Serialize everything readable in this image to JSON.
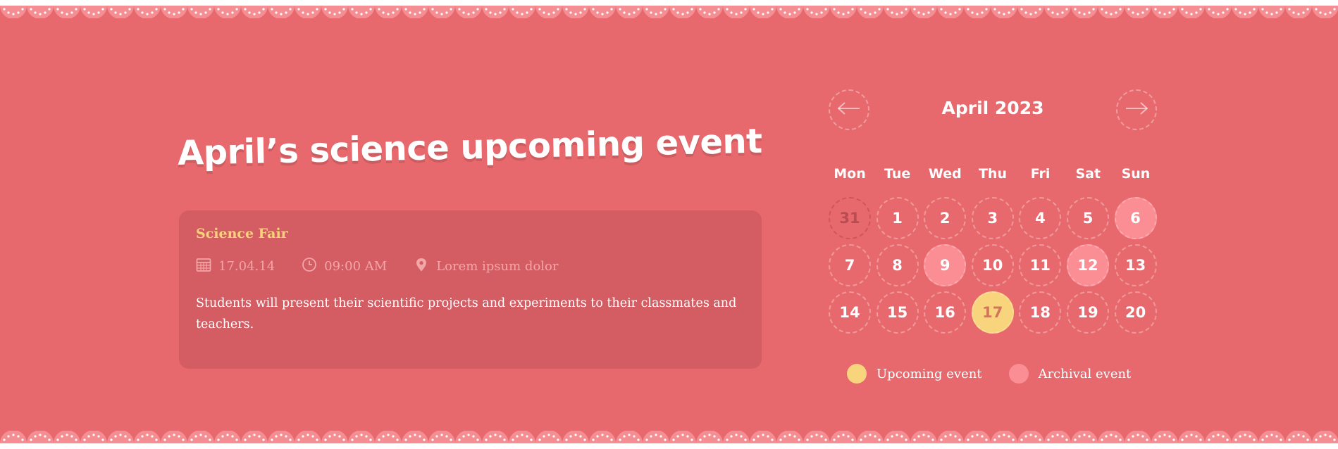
{
  "page": {
    "title": "April’s science upcoming event"
  },
  "event": {
    "name": "Science Fair",
    "date": "17.04.14",
    "time": "09:00 AM",
    "location": "Lorem ipsum dolor",
    "description": "Students will present their scientific projects and experiments to their classmates and teachers."
  },
  "calendar": {
    "month_label": "April 2023",
    "prev_icon": "arrow-left-icon",
    "next_icon": "arrow-right-icon",
    "weekdays": [
      "Mon",
      "Tue",
      "Wed",
      "Thu",
      "Fri",
      "Sat",
      "Sun"
    ],
    "days": [
      {
        "label": "31",
        "state": "muted"
      },
      {
        "label": "1",
        "state": "normal"
      },
      {
        "label": "2",
        "state": "normal"
      },
      {
        "label": "3",
        "state": "normal"
      },
      {
        "label": "4",
        "state": "normal"
      },
      {
        "label": "5",
        "state": "normal"
      },
      {
        "label": "6",
        "state": "archival"
      },
      {
        "label": "7",
        "state": "normal"
      },
      {
        "label": "8",
        "state": "normal"
      },
      {
        "label": "9",
        "state": "archival"
      },
      {
        "label": "10",
        "state": "normal"
      },
      {
        "label": "11",
        "state": "normal"
      },
      {
        "label": "12",
        "state": "archival"
      },
      {
        "label": "13",
        "state": "normal"
      },
      {
        "label": "14",
        "state": "normal"
      },
      {
        "label": "15",
        "state": "normal"
      },
      {
        "label": "16",
        "state": "normal"
      },
      {
        "label": "17",
        "state": "upcoming"
      },
      {
        "label": "18",
        "state": "normal"
      },
      {
        "label": "19",
        "state": "normal"
      },
      {
        "label": "20",
        "state": "normal"
      }
    ]
  },
  "legend": {
    "upcoming_label": "Upcoming event",
    "archival_label": "Archival event"
  },
  "colors": {
    "background": "#e8696d",
    "card": "#d35d63",
    "accent_yellow": "#f8d57c",
    "accent_pink": "#fb8e94",
    "event_name": "#f6d27a"
  }
}
